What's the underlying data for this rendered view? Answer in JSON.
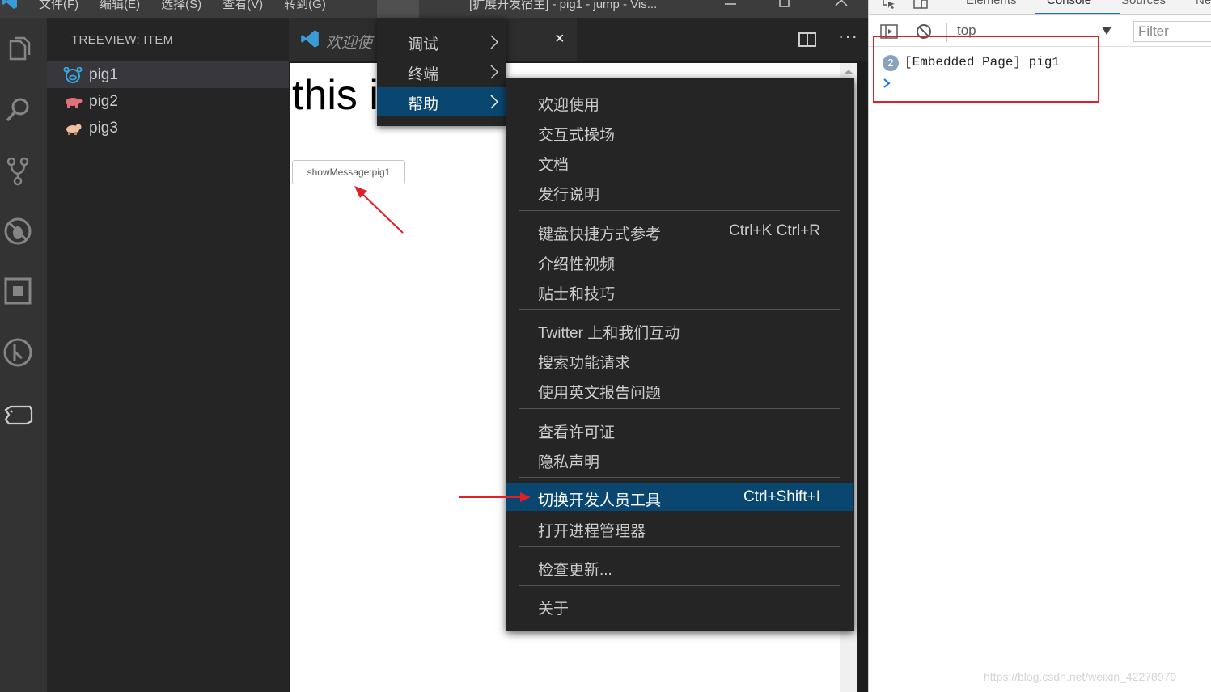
{
  "titlebar": {
    "menus": [
      "文件(F)",
      "编辑(E)",
      "选择(S)",
      "查看(V)",
      "转到(G)"
    ],
    "more": "···",
    "window_title": "[扩展开发宿主] - pig1 - jump - Vis..."
  },
  "sidebar": {
    "title": "TREEVIEW: ITEM",
    "items": [
      {
        "label": "pig1",
        "icon": "pig-face-icon"
      },
      {
        "label": "pig2",
        "icon": "pig-icon"
      },
      {
        "label": "pig3",
        "icon": "pig-icon"
      }
    ]
  },
  "editor": {
    "tab_label": "欢迎使",
    "tab_close": "×",
    "more": "···"
  },
  "webview": {
    "heading": "this i",
    "button_label": "showMessage:pig1"
  },
  "menu_level1": {
    "items": [
      {
        "label": "调试"
      },
      {
        "label": "终端"
      },
      {
        "label": "帮助",
        "active": true
      }
    ]
  },
  "help_menu": {
    "items": [
      {
        "label": "欢迎使用",
        "shortcut": ""
      },
      {
        "label": "交互式操场",
        "shortcut": ""
      },
      {
        "label": "文档",
        "shortcut": ""
      },
      {
        "label": "发行说明",
        "shortcut": ""
      },
      {
        "label": "键盘快捷方式参考",
        "shortcut": "Ctrl+K Ctrl+R"
      },
      {
        "label": "介绍性视频",
        "shortcut": ""
      },
      {
        "label": "贴士和技巧",
        "shortcut": ""
      },
      {
        "label": "Twitter 上和我们互动",
        "shortcut": ""
      },
      {
        "label": "搜索功能请求",
        "shortcut": ""
      },
      {
        "label": "使用英文报告问题",
        "shortcut": ""
      },
      {
        "label": "查看许可证",
        "shortcut": ""
      },
      {
        "label": "隐私声明",
        "shortcut": ""
      },
      {
        "label": "切换开发人员工具",
        "shortcut": "Ctrl+Shift+I",
        "active": true
      },
      {
        "label": "打开进程管理器",
        "shortcut": ""
      },
      {
        "label": "检查更新...",
        "shortcut": ""
      },
      {
        "label": "关于",
        "shortcut": ""
      }
    ]
  },
  "devtools": {
    "tabs": [
      "Elements",
      "Console",
      "Sources",
      "Ne"
    ],
    "active_tab": "Console",
    "context": "top",
    "filter_placeholder": "Filter",
    "message_count": "2",
    "message": "[Embedded Page] pig1"
  },
  "colors": {
    "menu_highlight": "#094771",
    "annotation_red": "#e01f26",
    "devtools_accent": "#1a73e8"
  },
  "watermark": "https://blog.csdn.net/weixin_42278979"
}
